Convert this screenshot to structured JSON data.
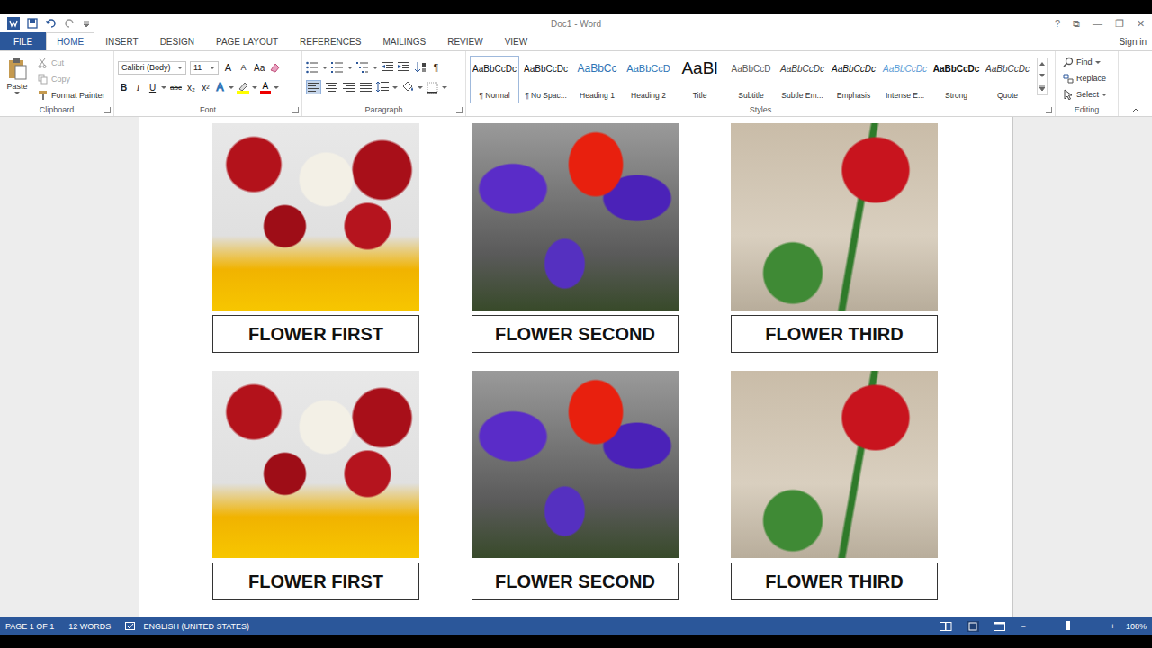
{
  "window": {
    "title": "Doc1 - Word",
    "controls": [
      "?",
      "⧉",
      "—",
      "❐",
      "✕"
    ]
  },
  "tabs": [
    {
      "label": "FILE",
      "selected": false
    },
    {
      "label": "HOME",
      "selected": true
    },
    {
      "label": "INSERT",
      "selected": false
    },
    {
      "label": "DESIGN",
      "selected": false
    },
    {
      "label": "PAGE LAYOUT",
      "selected": false
    },
    {
      "label": "REFERENCES",
      "selected": false
    },
    {
      "label": "MAILINGS",
      "selected": false
    },
    {
      "label": "REVIEW",
      "selected": false
    },
    {
      "label": "VIEW",
      "selected": false
    }
  ],
  "account": {
    "label": "Sign in"
  },
  "ribbon": {
    "clipboard": {
      "label": "Clipboard",
      "paste": "Paste",
      "items": [
        {
          "label": "Cut",
          "disabled": true
        },
        {
          "label": "Copy",
          "disabled": true
        },
        {
          "label": "Format Painter",
          "disabled": false
        }
      ]
    },
    "font": {
      "label": "Font",
      "family": "Calibri (Body)",
      "size": "11",
      "row1": [
        "A",
        "A",
        "Aa"
      ],
      "row2": [
        "B",
        "I",
        "U",
        "abc",
        "x₂",
        "x²"
      ],
      "color_letters": [
        "A",
        "A"
      ]
    },
    "paragraph": {
      "label": "Paragraph",
      "pilcrow": "¶",
      "alignment": [
        {
          "selected": true
        },
        {
          "selected": false
        },
        {
          "selected": false
        },
        {
          "selected": false
        }
      ]
    },
    "styles": {
      "label": "Styles",
      "items": [
        {
          "sample": "AaBbCcDc",
          "name": "¶ Normal",
          "kind": "normal",
          "selected": true
        },
        {
          "sample": "AaBbCcDc",
          "name": "¶ No Spac...",
          "kind": "normal",
          "selected": false
        },
        {
          "sample": "AaBbCc",
          "name": "Heading 1",
          "kind": "heading1",
          "selected": false
        },
        {
          "sample": "AaBbCcD",
          "name": "Heading 2",
          "kind": "heading2",
          "selected": false
        },
        {
          "sample": "AaBl",
          "name": "Title",
          "kind": "title",
          "selected": false
        },
        {
          "sample": "AaBbCcD",
          "name": "Subtitle",
          "kind": "subtitle",
          "selected": false
        },
        {
          "sample": "AaBbCcDc",
          "name": "Subtle Em...",
          "kind": "subtle",
          "selected": false
        },
        {
          "sample": "AaBbCcDc",
          "name": "Emphasis",
          "kind": "emphasis",
          "selected": false
        },
        {
          "sample": "AaBbCcDc",
          "name": "Intense E...",
          "kind": "intense",
          "selected": false
        },
        {
          "sample": "AaBbCcDc",
          "name": "Strong",
          "kind": "strong",
          "selected": false
        },
        {
          "sample": "AaBbCcDc",
          "name": "Quote",
          "kind": "quote",
          "selected": false
        }
      ]
    },
    "editing": {
      "label": "Editing",
      "items": [
        "Find",
        "Replace",
        "Select"
      ]
    }
  },
  "document": {
    "rows": [
      [
        {
          "caption": "FLOWER FIRST"
        },
        {
          "caption": "FLOWER SECOND"
        },
        {
          "caption": "FLOWER THIRD"
        }
      ],
      [
        {
          "caption": "FLOWER FIRST"
        },
        {
          "caption": "FLOWER SECOND"
        },
        {
          "caption": "FLOWER THIRD"
        }
      ]
    ]
  },
  "status_bar": {
    "page": "PAGE 1 OF 1",
    "words": "12 WORDS",
    "language": "ENGLISH (UNITED STATES)",
    "zoom": {
      "minus": "−",
      "plus": "+",
      "level": 0.5,
      "reading": "108%"
    }
  }
}
